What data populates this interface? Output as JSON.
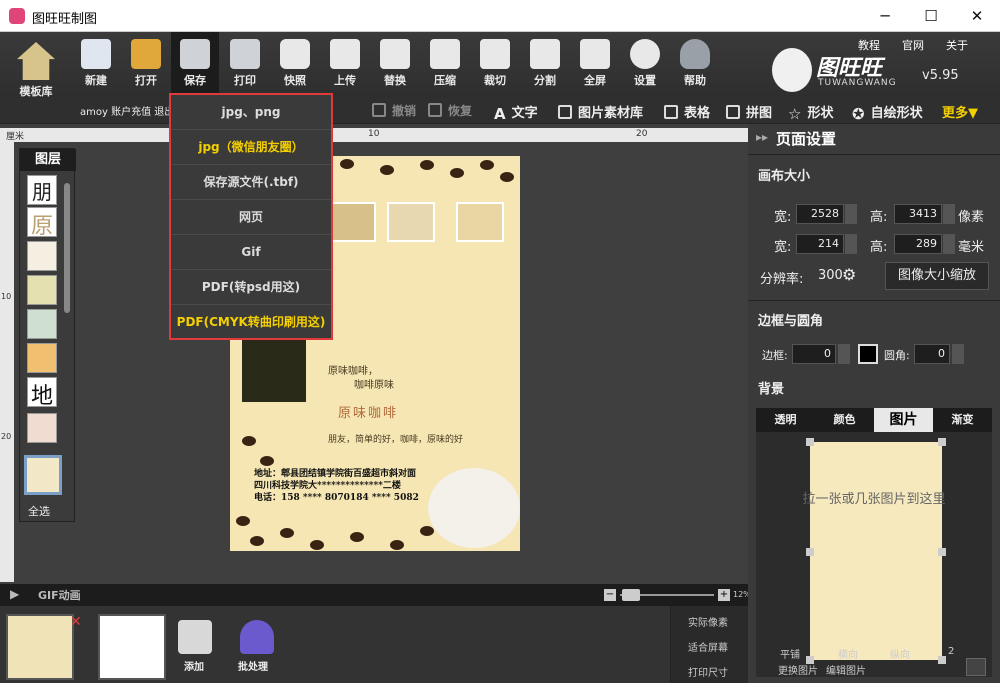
{
  "window": {
    "title": "图旺旺制图",
    "controls": {
      "min": "─",
      "max": "☐",
      "close": "✕"
    }
  },
  "toolbar": {
    "home": "模板库",
    "items": [
      "新建",
      "打开",
      "保存",
      "打印",
      "快照",
      "上传",
      "替换",
      "压缩",
      "裁切",
      "分割",
      "全屏",
      "设置",
      "帮助"
    ],
    "links": [
      "教程",
      "官网",
      "关于"
    ]
  },
  "brand": {
    "name": "图旺旺",
    "sub": "TUWANGWANG",
    "version": "v5.95"
  },
  "subbar": {
    "account": "amoy 账户充值 退出",
    "undo": "撤销",
    "redo": "恢复",
    "items": [
      "文字",
      "图片素材库",
      "表格",
      "拼图",
      "形状",
      "自绘形状"
    ],
    "more": "更多"
  },
  "ruler": {
    "unit": "厘米",
    "ticks_top": [
      "10",
      "20"
    ],
    "ticks_left": [
      "10",
      "20"
    ]
  },
  "layers": {
    "title": "图层",
    "select_all": "全选"
  },
  "save_menu": {
    "items": [
      {
        "label": "jpg、png",
        "highlight": false
      },
      {
        "label": "jpg（微信朋友圈）",
        "highlight": true
      },
      {
        "label": "保存源文件(.tbf)",
        "highlight": false
      },
      {
        "label": "网页",
        "highlight": false
      },
      {
        "label": "Gif",
        "highlight": false
      },
      {
        "label": "PDF(转psd用这)",
        "highlight": false
      },
      {
        "label": "PDF(CMYK转曲印刷用这)",
        "highlight": true
      }
    ]
  },
  "poster": {
    "line1": "原味咖啡，",
    "line2": "咖啡原味",
    "title": "原味咖啡",
    "slogan": "朋友，简单的好，咖啡，原味的好",
    "address": "地址：郫县团结镇学院街百盛超市斜对面",
    "address2": "四川科技学院大**************二楼",
    "phone": "电话：158 **** 8070184 **** 5082"
  },
  "bottom": {
    "gif_label": "GIF动画",
    "zoom": "12%",
    "add": "添加",
    "batch": "批处理",
    "actual": "实际像素",
    "fit": "适合屏幕",
    "print_size": "打印尺寸"
  },
  "right_panel": {
    "title": "页面设置",
    "canvas_size": "画布大小",
    "width_label": "宽:",
    "height_label": "高:",
    "px_w": "2528",
    "px_h": "3413",
    "px_unit": "像素",
    "mm_w": "214",
    "mm_h": "289",
    "mm_unit": "毫米",
    "dpi_label": "分辨率:",
    "dpi": "300",
    "scale_btn": "图像大小缩放",
    "border_section": "边框与圆角",
    "border_label": "边框:",
    "border_val": "0",
    "radius_label": "圆角:",
    "radius_val": "0",
    "bg_section": "背景",
    "bg_tabs": [
      "透明",
      "颜色",
      "图片",
      "渐变"
    ],
    "bg_active": "图片",
    "drop_hint": "拉一张或几张图片到这里",
    "bottom_left": "更换图片",
    "bottom_mid": "编辑图片",
    "tile": "平铺",
    "hgap": "横向",
    "vgap": "纵向",
    "hgap_val": "2",
    "vgap_val": "2"
  },
  "colors": {
    "highlight": "#f5d000",
    "menu_border": "#e03a3a",
    "panel": "#3a3a3a",
    "poster_bg": "#f5e6b4"
  }
}
